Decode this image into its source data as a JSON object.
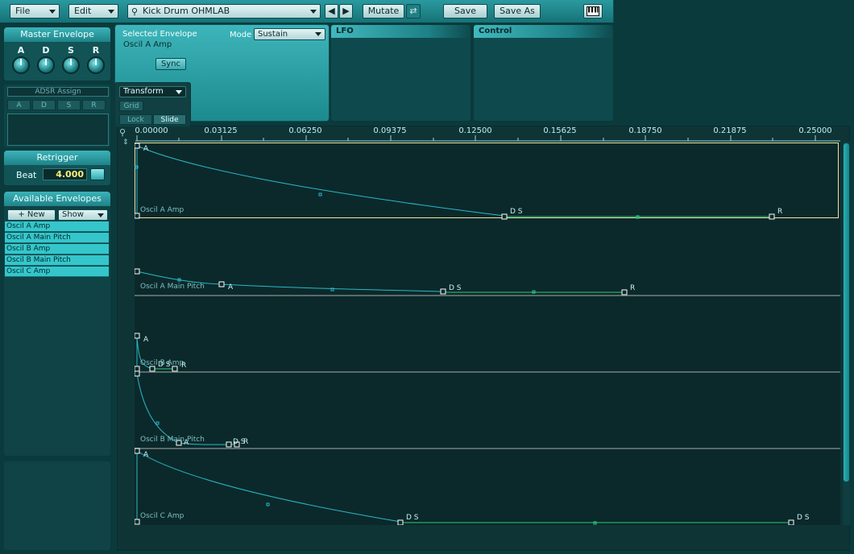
{
  "topbar": {
    "file_label": "File",
    "edit_label": "Edit",
    "preset_name": "Kick Drum OHMLAB",
    "mutate_label": "Mutate",
    "save_label": "Save",
    "save_as_label": "Save As",
    "icons": [
      "search-icon",
      "prev-arrow-icon",
      "next-arrow-icon",
      "mutate-lock-icon",
      "keyboard-icon"
    ]
  },
  "master_envelope": {
    "title": "Master Envelope",
    "knobs": [
      "A",
      "D",
      "S",
      "R"
    ]
  },
  "adsr_assign": {
    "title": "ADSR Assign",
    "buttons": [
      "A",
      "D",
      "S",
      "R"
    ]
  },
  "retrigger": {
    "title": "Retrigger",
    "beat_label": "Beat",
    "beat_value": "4.000"
  },
  "available_envelopes": {
    "title": "Available Envelopes",
    "new_label": "+ New",
    "show_label": "Show",
    "items": [
      "Oscil A Amp",
      "Oscil A Main Pitch",
      "Oscil B Amp",
      "Oscil B Main Pitch",
      "Oscil C Amp"
    ]
  },
  "selected_envelope": {
    "title": "Selected Envelope",
    "name": "Oscil A Amp",
    "mode_label": "Mode",
    "mode_value": "Sustain",
    "sync_label": "Sync"
  },
  "lfo": {
    "title": "LFO"
  },
  "control": {
    "title": "Control"
  },
  "toolbox": {
    "transform_label": "Transform",
    "grid_label": "Grid",
    "lock_label": "Lock",
    "slide_label": "Slide"
  },
  "ruler": {
    "ticks": [
      "0.00000",
      "0.03125",
      "0.06250",
      "0.09375",
      "0.12500",
      "0.15625",
      "0.18750",
      "0.21875",
      "0.25000"
    ]
  },
  "lanes": [
    {
      "name": "Oscil A Amp",
      "points": [
        "A",
        "D S",
        "R"
      ]
    },
    {
      "name": "Oscil A Main Pitch",
      "points": [
        "A",
        "D S",
        "R"
      ]
    },
    {
      "name": "Oscil B Amp",
      "points": [
        "A",
        "D S",
        "R"
      ]
    },
    {
      "name": "Oscil B Main Pitch",
      "points": [
        "A",
        "D S",
        "R"
      ]
    },
    {
      "name": "Oscil C Amp",
      "points": [
        "A",
        "D S",
        "D S"
      ]
    }
  ],
  "colors": {
    "accent": "#35c6cb",
    "curve": "#29b9c8",
    "sustain_line": "#2fc97a",
    "selected_lane_border": "#e8e8a0"
  }
}
